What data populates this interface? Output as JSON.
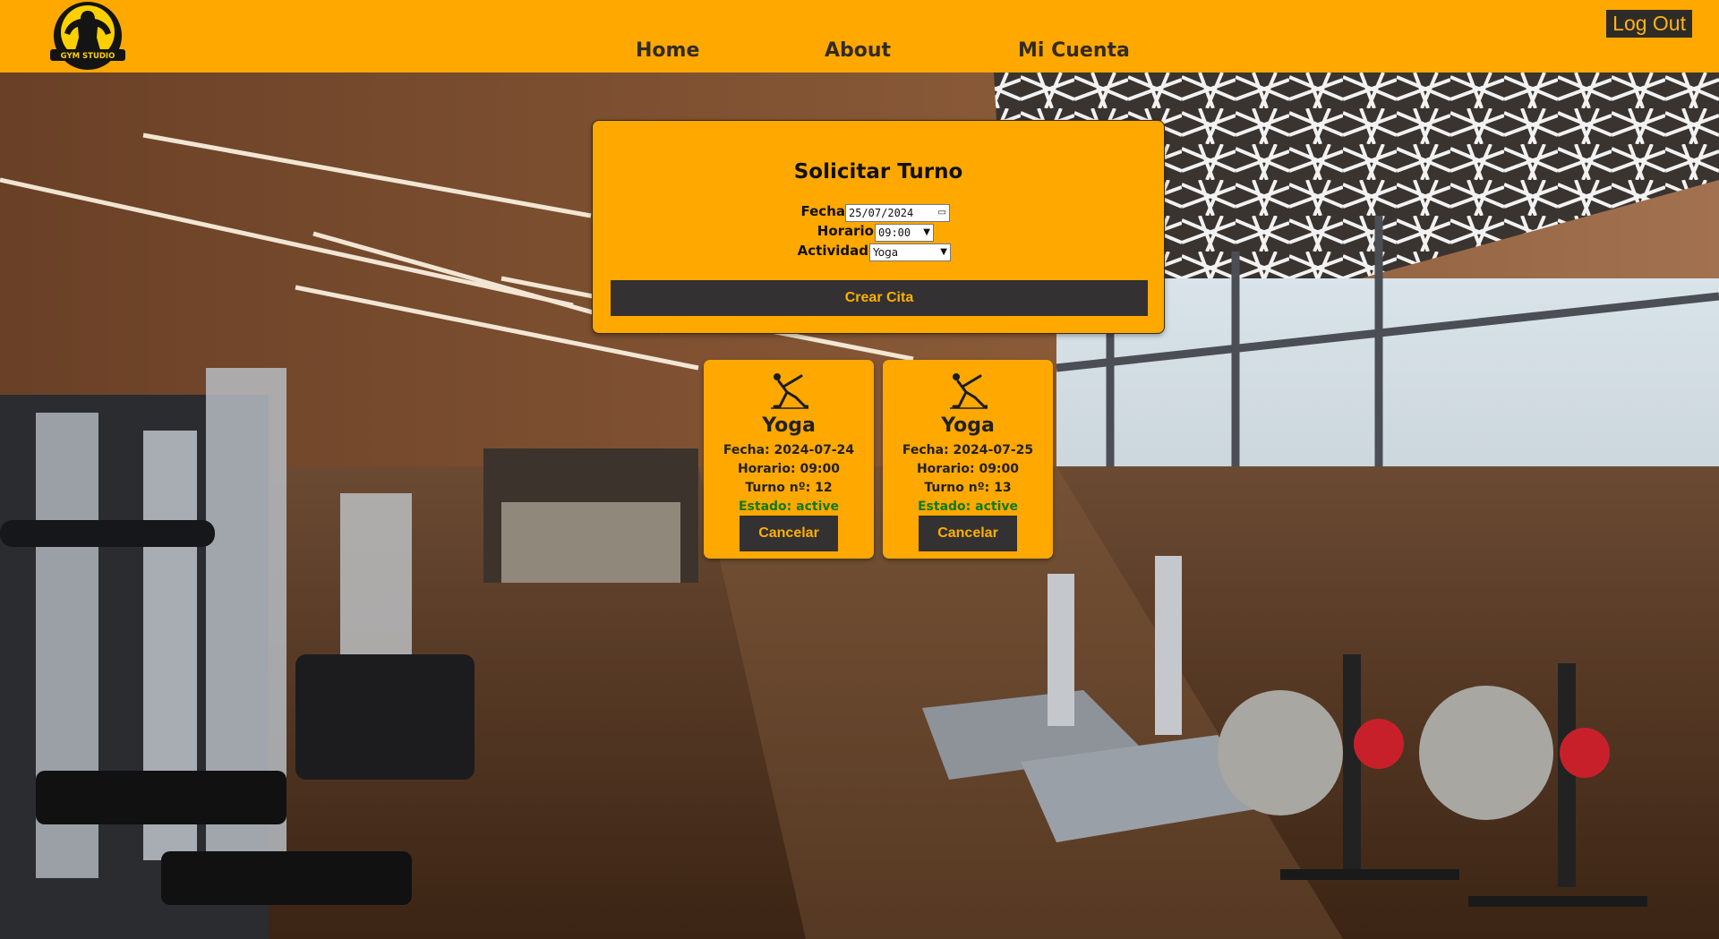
{
  "header": {
    "logo_text": "GYM STUDIO",
    "nav": {
      "home": "Home",
      "about": "About",
      "account": "Mi Cuenta"
    },
    "logout_label": "Log Out"
  },
  "form": {
    "title": "Solicitar Turno",
    "fecha_label": "Fecha",
    "fecha_value": "25/07/2024",
    "horario_label": "Horario",
    "horario_value": "09:00",
    "actividad_label": "Actividad",
    "actividad_value": "Yoga",
    "submit_label": "Crear Cita"
  },
  "appointments": [
    {
      "title": "Yoga",
      "fecha": "Fecha: 2024-07-24",
      "horario": "Horario: 09:00",
      "turno": "Turno nº: 12",
      "estado": "Estado: active",
      "cancel_label": "Cancelar"
    },
    {
      "title": "Yoga",
      "fecha": "Fecha: 2024-07-25",
      "horario": "Horario: 09:00",
      "turno": "Turno nº: 13",
      "estado": "Estado: active",
      "cancel_label": "Cancelar"
    }
  ],
  "colors": {
    "brand": "#ffa800",
    "dark": "#333131",
    "button_text": "#ffb000",
    "status_active": "#0f7a12"
  },
  "icons": {
    "logo": "bodybuilder-logo-icon",
    "activity": "yoga-pose-icon",
    "date_picker": "calendar-icon",
    "dropdown": "chevron-down-icon"
  }
}
